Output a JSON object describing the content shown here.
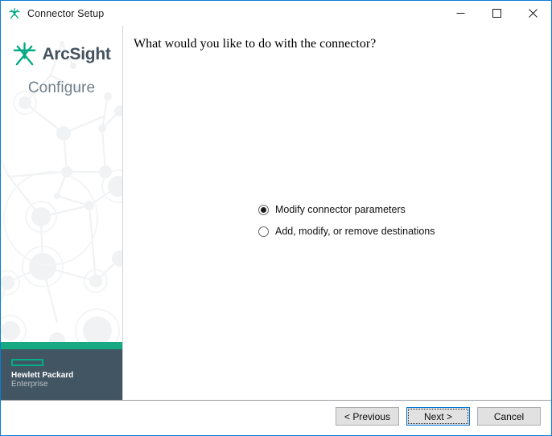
{
  "window": {
    "title": "Connector Setup",
    "title_icon": "arcsight-star-icon",
    "controls": {
      "minimize": "minimize-icon",
      "maximize": "maximize-icon",
      "close": "close-icon"
    }
  },
  "sidebar": {
    "brand_mark": "arcsight-star-icon",
    "brand_name": "ArcSight",
    "stage": "Configure",
    "vendor": {
      "logo": "hpe-element-logo",
      "line1": "Hewlett Packard",
      "line2": "Enterprise"
    },
    "colors": {
      "accent_green": "#00b188",
      "green_bar": "#16a982",
      "panel_dark": "#425563",
      "brand_text": "#44525f",
      "stage_text": "#72808c"
    }
  },
  "main": {
    "prompt": "What would you like to do with the connector?",
    "options": [
      {
        "label": "Modify connector parameters",
        "selected": true
      },
      {
        "label": "Add, modify, or remove destinations",
        "selected": false
      }
    ]
  },
  "footer": {
    "buttons": [
      {
        "label": "< Previous",
        "focused": false
      },
      {
        "label": "Next >",
        "focused": true
      },
      {
        "label": "Cancel",
        "focused": false
      }
    ]
  }
}
